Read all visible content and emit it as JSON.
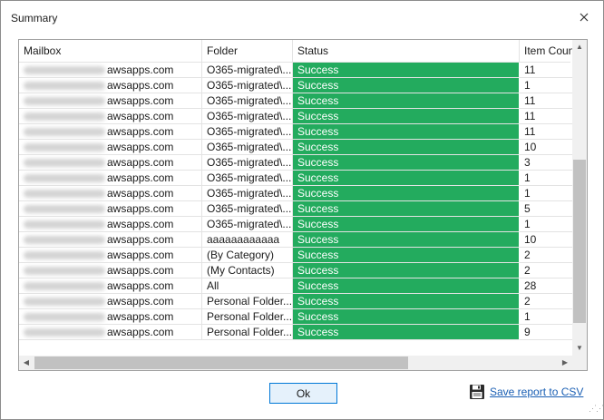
{
  "dialog": {
    "title": "Summary",
    "close_icon": "close-icon"
  },
  "table": {
    "columns": [
      "Mailbox",
      "Folder",
      "Status",
      "Item Count"
    ],
    "status_color": "#23ab5e",
    "rows": [
      {
        "mailbox": "awsapps.com",
        "folder": "O365-migrated\\...",
        "status": "Success",
        "count": "11"
      },
      {
        "mailbox": "awsapps.com",
        "folder": "O365-migrated\\...",
        "status": "Success",
        "count": "1"
      },
      {
        "mailbox": "awsapps.com",
        "folder": "O365-migrated\\...",
        "status": "Success",
        "count": "11"
      },
      {
        "mailbox": "awsapps.com",
        "folder": "O365-migrated\\...",
        "status": "Success",
        "count": "11"
      },
      {
        "mailbox": "awsapps.com",
        "folder": "O365-migrated\\...",
        "status": "Success",
        "count": "11"
      },
      {
        "mailbox": "awsapps.com",
        "folder": "O365-migrated\\...",
        "status": "Success",
        "count": "10"
      },
      {
        "mailbox": "awsapps.com",
        "folder": "O365-migrated\\...",
        "status": "Success",
        "count": "3"
      },
      {
        "mailbox": "awsapps.com",
        "folder": "O365-migrated\\...",
        "status": "Success",
        "count": "1"
      },
      {
        "mailbox": "awsapps.com",
        "folder": "O365-migrated\\...",
        "status": "Success",
        "count": "1"
      },
      {
        "mailbox": "awsapps.com",
        "folder": "O365-migrated\\...",
        "status": "Success",
        "count": "5"
      },
      {
        "mailbox": "awsapps.com",
        "folder": "O365-migrated\\...",
        "status": "Success",
        "count": "1"
      },
      {
        "mailbox": "awsapps.com",
        "folder": "aaaaaaaaaaaa",
        "status": "Success",
        "count": "10"
      },
      {
        "mailbox": "awsapps.com",
        "folder": "(By Category)",
        "status": "Success",
        "count": "2"
      },
      {
        "mailbox": "awsapps.com",
        "folder": "(My Contacts)",
        "status": "Success",
        "count": "2"
      },
      {
        "mailbox": "awsapps.com",
        "folder": "All",
        "status": "Success",
        "count": "28"
      },
      {
        "mailbox": "awsapps.com",
        "folder": "Personal Folder...",
        "status": "Success",
        "count": "2"
      },
      {
        "mailbox": "awsapps.com",
        "folder": "Personal Folder...",
        "status": "Success",
        "count": "1"
      },
      {
        "mailbox": "awsapps.com",
        "folder": "Personal Folder...",
        "status": "Success",
        "count": "9"
      }
    ]
  },
  "scrollbars": {
    "vertical_position": 0.85,
    "horizontal_position": 0.0
  },
  "footer": {
    "ok_label": "Ok",
    "save_label": "Save report to CSV",
    "save_icon": "floppy-disk-icon"
  }
}
